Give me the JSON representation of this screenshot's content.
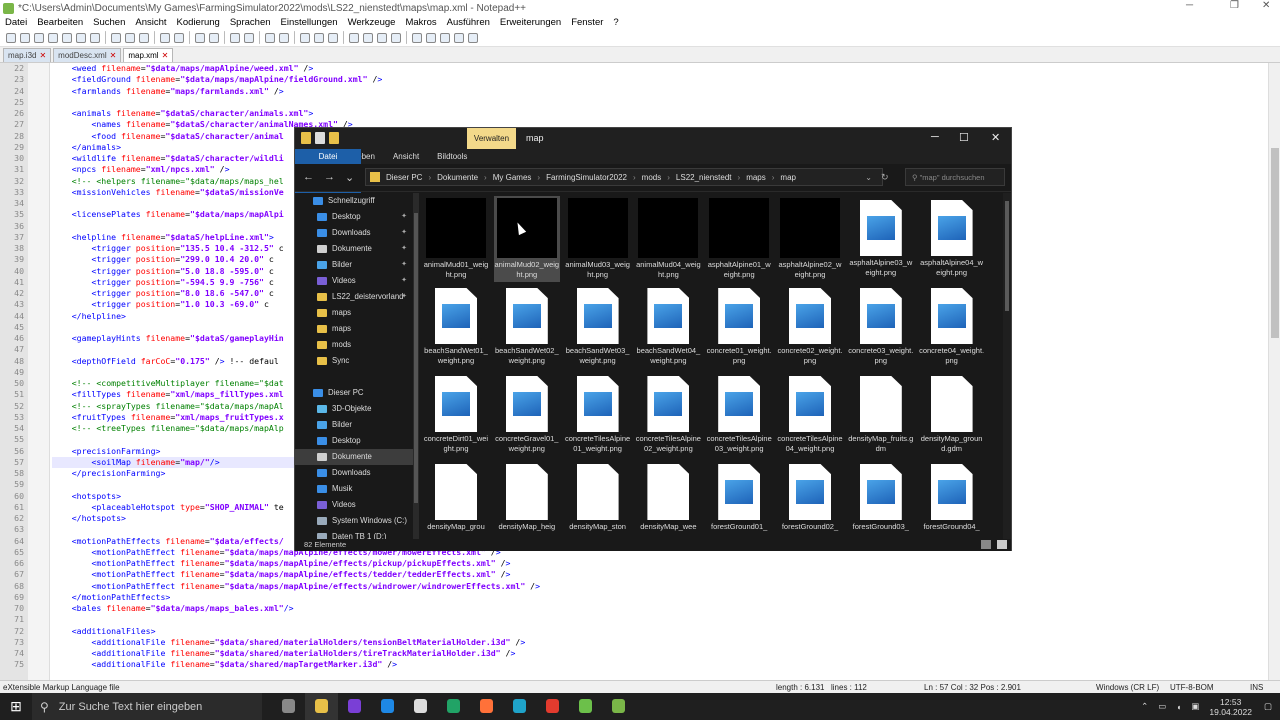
{
  "notepad": {
    "title": "*C:\\Users\\Admin\\Documents\\My Games\\FarmingSimulator2022\\mods\\LS22_nienstedt\\maps\\map.xml - Notepad++",
    "menu": [
      "Datei",
      "Bearbeiten",
      "Suchen",
      "Ansicht",
      "Kodierung",
      "Sprachen",
      "Einstellungen",
      "Werkzeuge",
      "Makros",
      "Ausführen",
      "Erweiterungen",
      "Fenster",
      "?"
    ],
    "tabs": [
      {
        "label": "map.i3d",
        "active": false
      },
      {
        "label": "modDesc.xml",
        "active": false
      },
      {
        "label": "map.xml",
        "active": true
      }
    ],
    "status": {
      "lang": "eXtensible Markup Language file",
      "length": "length : 6.131",
      "lines": "lines : 112",
      "pos": "Ln : 57    Col : 32    Pos : 2.901",
      "eol": "Windows (CR LF)",
      "enc": "UTF-8-BOM",
      "ins": "INS"
    },
    "line_numbers": [
      "22",
      "23",
      "24",
      "25",
      "26",
      "27",
      "28",
      "29",
      "30",
      "31",
      "32",
      "33",
      "34",
      "35",
      "36",
      "37",
      "38",
      "39",
      "40",
      "41",
      "42",
      "43",
      "44",
      "45",
      "46",
      "47",
      "48",
      "49",
      "50",
      "51",
      "52",
      "53",
      "54",
      "55",
      "56",
      "57",
      "58",
      "59",
      "60",
      "61",
      "62",
      "63",
      "64",
      "65",
      "66",
      "67",
      "68",
      "69",
      "70",
      "71",
      "72",
      "73",
      "74",
      "75"
    ],
    "code_lines": [
      "    <weed filename=\"$data/maps/mapAlpine/weed.xml\" />",
      "    <fieldGround filename=\"$data/maps/mapAlpine/fieldGround.xml\" />",
      "    <farmlands filename=\"maps/farmlands.xml\" />",
      "",
      "    <animals filename=\"$dataS/character/animals.xml\">",
      "        <names filename=\"$dataS/character/animalNames.xml\" />",
      "        <food filename=\"$dataS/character/animal",
      "    </animals>",
      "    <wildlife filename=\"$dataS/character/wildli",
      "    <npcs filename=\"xml/npcs.xml\" />",
      "    <!-- <helpers filename=\"$data/maps/maps_hel",
      "    <missionVehicles filename=\"$dataS/missionVe",
      "",
      "    <licensePlates filename=\"$data/maps/mapAlpi",
      "",
      "    <helpline filename=\"$dataS/helpLine.xml\">",
      "        <trigger position=\"135.5 10.4 -312.5\" c",
      "        <trigger position=\"299.0 10.4 20.0\" c",
      "        <trigger position=\"5.0 18.8 -595.0\" c",
      "        <trigger position=\"-594.5 9.9 -756\" c",
      "        <trigger position=\"8.0 18.6 -547.0\" c",
      "        <trigger position=\"1.0 10.3 -69.0\" c",
      "    </helpline>",
      "",
      "    <gameplayHints filename=\"$dataS/gameplayHin",
      "",
      "    <depthOfField farCoC=\"0.175\" /> <!-- defaul",
      "",
      "    <!-- <competitiveMultiplayer filename=\"$dat",
      "    <fillTypes filename=\"xml/maps_fillTypes.xml",
      "    <!-- <sprayTypes filename=\"$data/maps/mapAl",
      "    <fruitTypes filename=\"xml/maps_fruitTypes.x",
      "    <!-- <treeTypes filename=\"$data/maps/mapAlp",
      "",
      "    <precisionFarming>",
      "        <soilMap filename=\"map/\"/>",
      "    </precisionFarming>",
      "",
      "    <hotspots>",
      "        <placeableHotspot type=\"SHOP_ANIMAL\" te",
      "    </hotspots>",
      "",
      "    <motionPathEffects filename=\"$data/effects/",
      "        <motionPathEffect filename=\"$data/maps/mapAlpine/effects/mower/mowerEffects.xml\" />",
      "        <motionPathEffect filename=\"$data/maps/mapAlpine/effects/pickup/pickupEffects.xml\" />",
      "        <motionPathEffect filename=\"$data/maps/mapAlpine/effects/tedder/tedderEffects.xml\" />",
      "        <motionPathEffect filename=\"$data/maps/mapAlpine/effects/windrower/windrowerEffects.xml\" />",
      "    </motionPathEffects>",
      "    <bales filename=\"$data/maps/maps_bales.xml\"/>",
      "",
      "    <additionalFiles>",
      "        <additionalFile filename=\"$data/shared/materialHolders/tensionBeltMaterialHolder.i3d\" />",
      "        <additionalFile filename=\"$data/shared/materialHolders/tireTrackMaterialHolder.i3d\" />",
      "        <additionalFile filename=\"$data/shared/mapTargetMarker.i3d\" />"
    ]
  },
  "explorer": {
    "ribbon_context": "Verwalten",
    "title": "map",
    "ribbon_tabs": [
      "Datei",
      "Start",
      "Freigeben",
      "Ansicht",
      "Bildtools"
    ],
    "path": [
      "Dieser PC",
      "Dokumente",
      "My Games",
      "FarmingSimulator2022",
      "mods",
      "LS22_nienstedt",
      "maps",
      "map"
    ],
    "search_placeholder": "\"map\" durchsuchen",
    "status": "82 Elemente",
    "sidebar": [
      {
        "label": "Schnellzugriff",
        "icon": "star-icon",
        "color": "#3a8ee6",
        "indent": 18,
        "pin": false
      },
      {
        "label": "Desktop",
        "icon": "desktop-icon",
        "color": "#3a8ee6",
        "indent": 22,
        "pin": true
      },
      {
        "label": "Downloads",
        "icon": "download-icon",
        "color": "#3a8ee6",
        "indent": 22,
        "pin": true
      },
      {
        "label": "Dokumente",
        "icon": "documents-icon",
        "color": "#cfcfcf",
        "indent": 22,
        "pin": true
      },
      {
        "label": "Bilder",
        "icon": "pictures-icon",
        "color": "#4aa3e8",
        "indent": 22,
        "pin": true
      },
      {
        "label": "Videos",
        "icon": "videos-icon",
        "color": "#7a5fd6",
        "indent": 22,
        "pin": true
      },
      {
        "label": "LS22_deistervorland",
        "icon": "folder-icon",
        "color": "#e8c048",
        "indent": 22,
        "pin": true
      },
      {
        "label": "maps",
        "icon": "folder-icon",
        "color": "#e8c048",
        "indent": 22,
        "pin": false
      },
      {
        "label": "maps",
        "icon": "folder-icon",
        "color": "#e8c048",
        "indent": 22,
        "pin": false
      },
      {
        "label": "mods",
        "icon": "folder-icon",
        "color": "#e8c048",
        "indent": 22,
        "pin": false
      },
      {
        "label": "Sync",
        "icon": "folder-icon",
        "color": "#e8c048",
        "indent": 22,
        "pin": false
      },
      {
        "label": "",
        "icon": "",
        "color": "transparent",
        "indent": 22,
        "pin": false
      },
      {
        "label": "Dieser PC",
        "icon": "computer-icon",
        "color": "#3a8ee6",
        "indent": 18,
        "pin": false
      },
      {
        "label": "3D-Objekte",
        "icon": "3d-objects-icon",
        "color": "#5bb8e8",
        "indent": 22,
        "pin": false
      },
      {
        "label": "Bilder",
        "icon": "pictures-icon",
        "color": "#4aa3e8",
        "indent": 22,
        "pin": false
      },
      {
        "label": "Desktop",
        "icon": "desktop-icon",
        "color": "#3a8ee6",
        "indent": 22,
        "pin": false
      },
      {
        "label": "Dokumente",
        "icon": "documents-icon",
        "color": "#cfcfcf",
        "indent": 22,
        "pin": false,
        "selected": true
      },
      {
        "label": "Downloads",
        "icon": "download-icon",
        "color": "#3a8ee6",
        "indent": 22,
        "pin": false
      },
      {
        "label": "Musik",
        "icon": "music-icon",
        "color": "#3a8ee6",
        "indent": 22,
        "pin": false
      },
      {
        "label": "Videos",
        "icon": "videos-icon",
        "color": "#7a5fd6",
        "indent": 22,
        "pin": false
      },
      {
        "label": "System Windows (C:)",
        "icon": "drive-icon",
        "color": "#9ab",
        "indent": 22,
        "pin": false
      },
      {
        "label": "Daten TB 1 (D:)",
        "icon": "drive-icon",
        "color": "#9ab",
        "indent": 22,
        "pin": false
      }
    ],
    "files": [
      {
        "name": "animalMud01_weight.png",
        "thumb": "black"
      },
      {
        "name": "animalMud02_weight.png",
        "thumb": "black",
        "selected": true
      },
      {
        "name": "animalMud03_weight.png",
        "thumb": "black"
      },
      {
        "name": "animalMud04_weight.png",
        "thumb": "black"
      },
      {
        "name": "asphaltAlpine01_weight.png",
        "thumb": "black"
      },
      {
        "name": "asphaltAlpine02_weight.png",
        "thumb": "black"
      },
      {
        "name": "asphaltAlpine03_weight.png",
        "thumb": "img"
      },
      {
        "name": "asphaltAlpine04_weight.png",
        "thumb": "img"
      },
      {
        "name": "beachSandWet01_weight.png",
        "thumb": "img"
      },
      {
        "name": "beachSandWet02_weight.png",
        "thumb": "img"
      },
      {
        "name": "beachSandWet03_weight.png",
        "thumb": "img"
      },
      {
        "name": "beachSandWet04_weight.png",
        "thumb": "img"
      },
      {
        "name": "concrete01_weight.png",
        "thumb": "img"
      },
      {
        "name": "concrete02_weight.png",
        "thumb": "img"
      },
      {
        "name": "concrete03_weight.png",
        "thumb": "img"
      },
      {
        "name": "concrete04_weight.png",
        "thumb": "img"
      },
      {
        "name": "concreteDirt01_weight.png",
        "thumb": "img"
      },
      {
        "name": "concreteGravel01_weight.png",
        "thumb": "img"
      },
      {
        "name": "concreteTilesAlpine01_weight.png",
        "thumb": "img"
      },
      {
        "name": "concreteTilesAlpine02_weight.png",
        "thumb": "img"
      },
      {
        "name": "concreteTilesAlpine03_weight.png",
        "thumb": "img"
      },
      {
        "name": "concreteTilesAlpine04_weight.png",
        "thumb": "img"
      },
      {
        "name": "densityMap_fruits.gdm",
        "thumb": "doc"
      },
      {
        "name": "densityMap_ground.gdm",
        "thumb": "doc"
      },
      {
        "name": "densityMap_grou",
        "thumb": "doc"
      },
      {
        "name": "densityMap_heig",
        "thumb": "doc"
      },
      {
        "name": "densityMap_ston",
        "thumb": "doc"
      },
      {
        "name": "densityMap_wee",
        "thumb": "doc"
      },
      {
        "name": "forestGround01_",
        "thumb": "img"
      },
      {
        "name": "forestGround02_",
        "thumb": "img"
      },
      {
        "name": "forestGround03_",
        "thumb": "img"
      },
      {
        "name": "forestGround04_",
        "thumb": "img"
      }
    ]
  },
  "taskbar": {
    "search_placeholder": "Zur Suche Text hier eingeben",
    "time": "12:53",
    "date": "19.04.2022",
    "apps": [
      {
        "name": "task-view-icon",
        "color": "#888"
      },
      {
        "name": "file-explorer-icon",
        "color": "#e8c048",
        "active": true
      },
      {
        "name": "app-icon",
        "color": "#7a3fd6"
      },
      {
        "name": "app-icon",
        "color": "#1e88e5"
      },
      {
        "name": "app-icon",
        "color": "#ddd"
      },
      {
        "name": "app-icon",
        "color": "#21a366"
      },
      {
        "name": "firefox-icon",
        "color": "#ff7139"
      },
      {
        "name": "edge-icon",
        "color": "#1fa3c9"
      },
      {
        "name": "chrome-icon",
        "color": "#e33b2e"
      },
      {
        "name": "app-icon",
        "color": "#6cc04a"
      },
      {
        "name": "notepad-plus-plus-icon",
        "color": "#7ab648"
      }
    ]
  }
}
